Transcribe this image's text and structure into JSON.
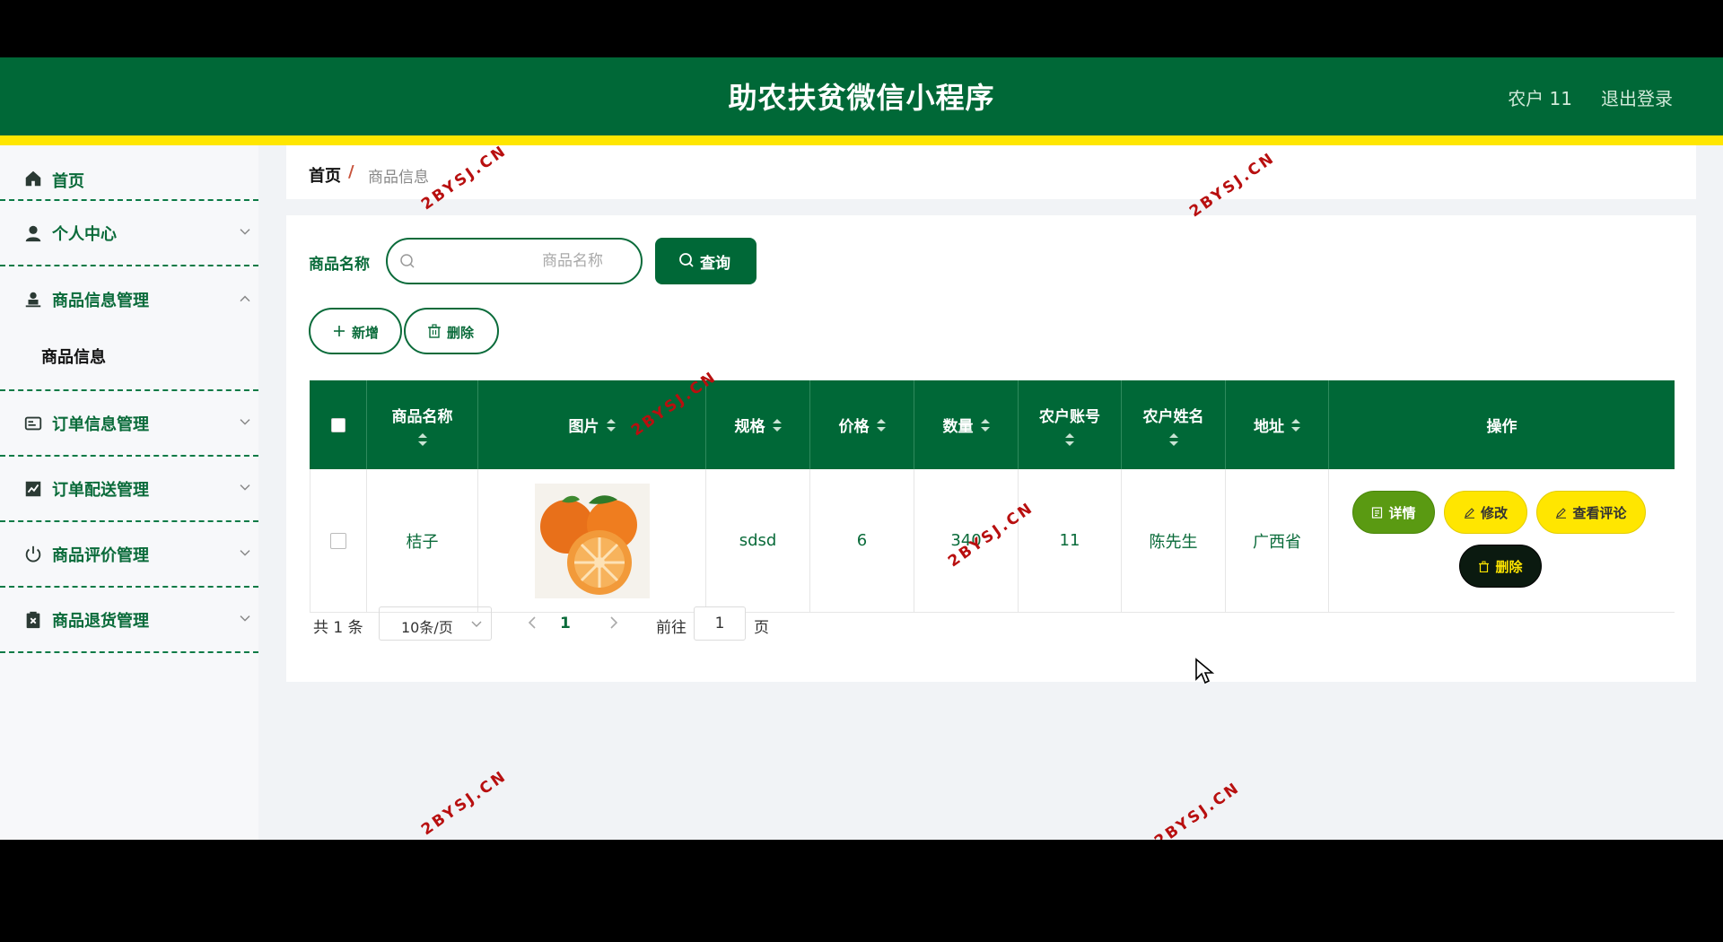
{
  "header": {
    "title": "助农扶贫微信小程序",
    "user": "农户 11",
    "logout": "退出登录"
  },
  "sidebar": {
    "items": [
      {
        "label": "首页",
        "icon": "home-icon"
      },
      {
        "label": "个人中心",
        "icon": "user-icon"
      },
      {
        "label": "商品信息管理",
        "icon": "person-icon",
        "expanded": true,
        "children": [
          "商品信息"
        ]
      },
      {
        "label": "订单信息管理",
        "icon": "card-icon"
      },
      {
        "label": "订单配送管理",
        "icon": "chart-icon"
      },
      {
        "label": "商品评价管理",
        "icon": "power-icon"
      },
      {
        "label": "商品退货管理",
        "icon": "clipboard-icon"
      }
    ]
  },
  "breadcrumb": {
    "home": "首页",
    "separator": "/",
    "current": "商品信息"
  },
  "search": {
    "label": "商品名称",
    "placeholder": "商品名称",
    "button": "查询"
  },
  "actions": {
    "add": "新增",
    "delete": "删除"
  },
  "table": {
    "headers": [
      "商品名称",
      "图片",
      "规格",
      "价格",
      "数量",
      "农户账号",
      "农户姓名",
      "地址",
      "操作"
    ],
    "rows": [
      {
        "name": "桔子",
        "image": "orange-photo",
        "spec": "sdsd",
        "price": "6",
        "quantity": "340",
        "account": "11",
        "farmer": "陈先生",
        "address": "广西省"
      }
    ],
    "row_actions": {
      "detail": "详情",
      "edit": "修改",
      "review": "查看评论",
      "delete": "删除"
    }
  },
  "pagination": {
    "total": "共 1 条",
    "page_size": "10条/页",
    "current_page": "1",
    "goto_label": "前往",
    "goto_value": "1",
    "page_suffix": "页"
  },
  "watermark": "2BYSJ.CN",
  "colors": {
    "primary": "#006837",
    "accent": "#ffe600",
    "detail_button": "#5a9a12",
    "delete_button": "#0b1a10"
  }
}
